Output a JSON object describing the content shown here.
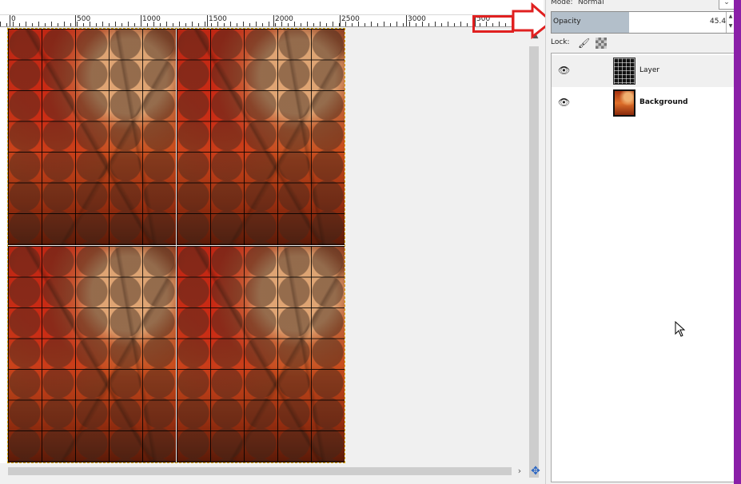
{
  "ruler": {
    "labels": [
      "0",
      "500",
      "1000",
      "1500",
      "2000",
      "2500",
      "3000",
      "500"
    ]
  },
  "layers_panel": {
    "mode_label": "Mode:",
    "mode_value": "Normal",
    "opacity_label": "Opacity",
    "opacity_value": "45.4",
    "lock_label": "Lock:",
    "layers": [
      {
        "name": "Layer",
        "visible": true,
        "selected": true
      },
      {
        "name": "Background",
        "visible": true,
        "selected": false
      }
    ]
  },
  "colors": {
    "annotation": "#e02020",
    "opacity_fill": "#b3bfca",
    "side_bar": "#8a1fa8"
  }
}
